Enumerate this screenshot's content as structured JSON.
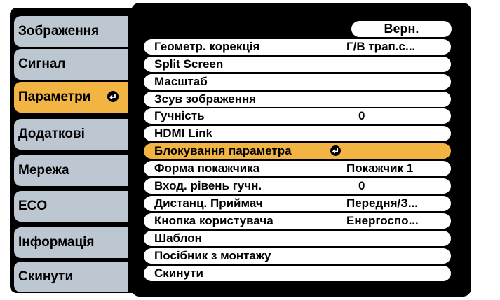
{
  "sidebar": {
    "tabs": [
      {
        "label": "Зображення"
      },
      {
        "label": "Сигнал"
      },
      {
        "label": "Параметри"
      },
      {
        "label": "Додаткові"
      },
      {
        "label": "Мережа"
      },
      {
        "label": "ECO"
      },
      {
        "label": "Інформація"
      },
      {
        "label": "Скинути"
      }
    ],
    "active_index": 2
  },
  "menu": {
    "badge": "Верн.",
    "items": [
      {
        "label": "Геометр. корекція",
        "value": "Г/В трап.с..."
      },
      {
        "label": "Split Screen",
        "value": ""
      },
      {
        "label": "Масштаб",
        "value": ""
      },
      {
        "label": "Зсув зображення",
        "value": ""
      },
      {
        "label": "Гучність",
        "value": "0"
      },
      {
        "label": "HDMI Link",
        "value": ""
      },
      {
        "label": "Блокування параметра",
        "value": ""
      },
      {
        "label": "Форма покажчика",
        "value": "Покажчик 1"
      },
      {
        "label": "Вход. рівень гучн.",
        "value": "0"
      },
      {
        "label": "Дистанц. Приймач",
        "value": "Передня/З..."
      },
      {
        "label": "Кнопка користувача",
        "value": "Енергоспо..."
      },
      {
        "label": "Шаблон",
        "value": ""
      },
      {
        "label": "Посібник з монтажу",
        "value": ""
      },
      {
        "label": "Скинути",
        "value": ""
      }
    ],
    "selected_index": 6
  },
  "colors": {
    "selection": "#f2b544",
    "tab_bg": "#bcc7d2",
    "panel_bg": "#000000",
    "row_bg": "#ffffff"
  },
  "icons": {
    "enter": "enter-icon"
  }
}
